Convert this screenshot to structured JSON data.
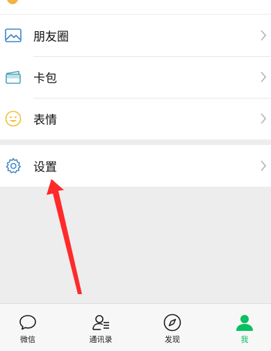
{
  "menu": {
    "group1": [
      {
        "label": "朋友圈",
        "icon": "moments-icon"
      },
      {
        "label": "卡包",
        "icon": "card-wallet-icon"
      },
      {
        "label": "表情",
        "icon": "sticker-smiley-icon"
      }
    ],
    "group2": [
      {
        "label": "设置",
        "icon": "settings-gear-icon"
      }
    ]
  },
  "tabbar": {
    "tabs": [
      {
        "label": "微信",
        "icon": "chat-bubble-icon",
        "active": false
      },
      {
        "label": "通讯录",
        "icon": "contacts-icon",
        "active": false
      },
      {
        "label": "发现",
        "icon": "compass-icon",
        "active": false
      },
      {
        "label": "我",
        "icon": "person-icon",
        "active": true
      }
    ]
  },
  "colors": {
    "accent": "#07c160",
    "annotation_arrow": "#ff2a2a",
    "icon_blue": "#3b83c4",
    "icon_yellow": "#f0c030",
    "icon_teal": "#4aa0b8"
  }
}
